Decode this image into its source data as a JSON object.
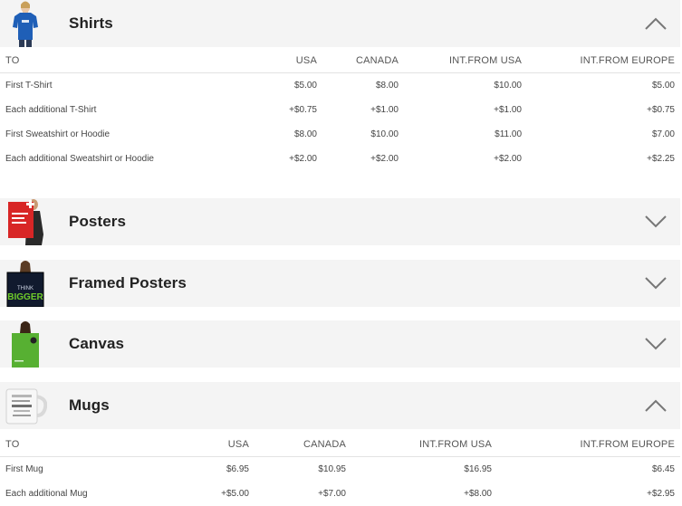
{
  "sections": [
    {
      "title": "Shirts",
      "expanded": true,
      "thumb_icon": "person-wearing-blue-tshirt",
      "headers": [
        "TO",
        "USA",
        "CANADA",
        "INT.FROM USA",
        "INT.FROM EUROPE"
      ],
      "rows": [
        [
          "First T-Shirt",
          "$5.00",
          "$8.00",
          "$10.00",
          "$5.00"
        ],
        [
          "Each additional T-Shirt",
          "+$0.75",
          "+$1.00",
          "+$1.00",
          "+$0.75"
        ],
        [
          "First Sweatshirt or Hoodie",
          "$8.00",
          "$10.00",
          "$11.00",
          "$7.00"
        ],
        [
          "Each additional Sweatshirt or Hoodie",
          "+$2.00",
          "+$2.00",
          "+$2.00",
          "+$2.25"
        ]
      ]
    },
    {
      "title": "Posters",
      "expanded": false,
      "thumb_icon": "person-holding-red-poster"
    },
    {
      "title": "Framed Posters",
      "expanded": false,
      "thumb_icon": "person-holding-framed-poster",
      "thumb_text": "THINK BIGGER"
    },
    {
      "title": "Canvas",
      "expanded": false,
      "thumb_icon": "person-holding-green-canvas"
    },
    {
      "title": "Mugs",
      "expanded": true,
      "thumb_icon": "white-mug",
      "headers": [
        "TO",
        "USA",
        "CANADA",
        "INT.FROM USA",
        "INT.FROM EUROPE"
      ],
      "rows": [
        [
          "First Mug",
          "$6.95",
          "$10.95",
          "$16.95",
          "$6.45"
        ],
        [
          "Each additional Mug",
          "+$5.00",
          "+$7.00",
          "+$8.00",
          "+$2.95"
        ]
      ]
    }
  ],
  "icons": {
    "expanded": "chevron-up-icon",
    "collapsed": "chevron-down-icon"
  },
  "colors": {
    "header_bg": "#f4f4f4",
    "chevron": "#777777",
    "shirt_blue": "#1f5fb7",
    "poster_red": "#d82626",
    "canvas_green": "#57b032",
    "think_bigger_green": "#6ecb2a"
  }
}
